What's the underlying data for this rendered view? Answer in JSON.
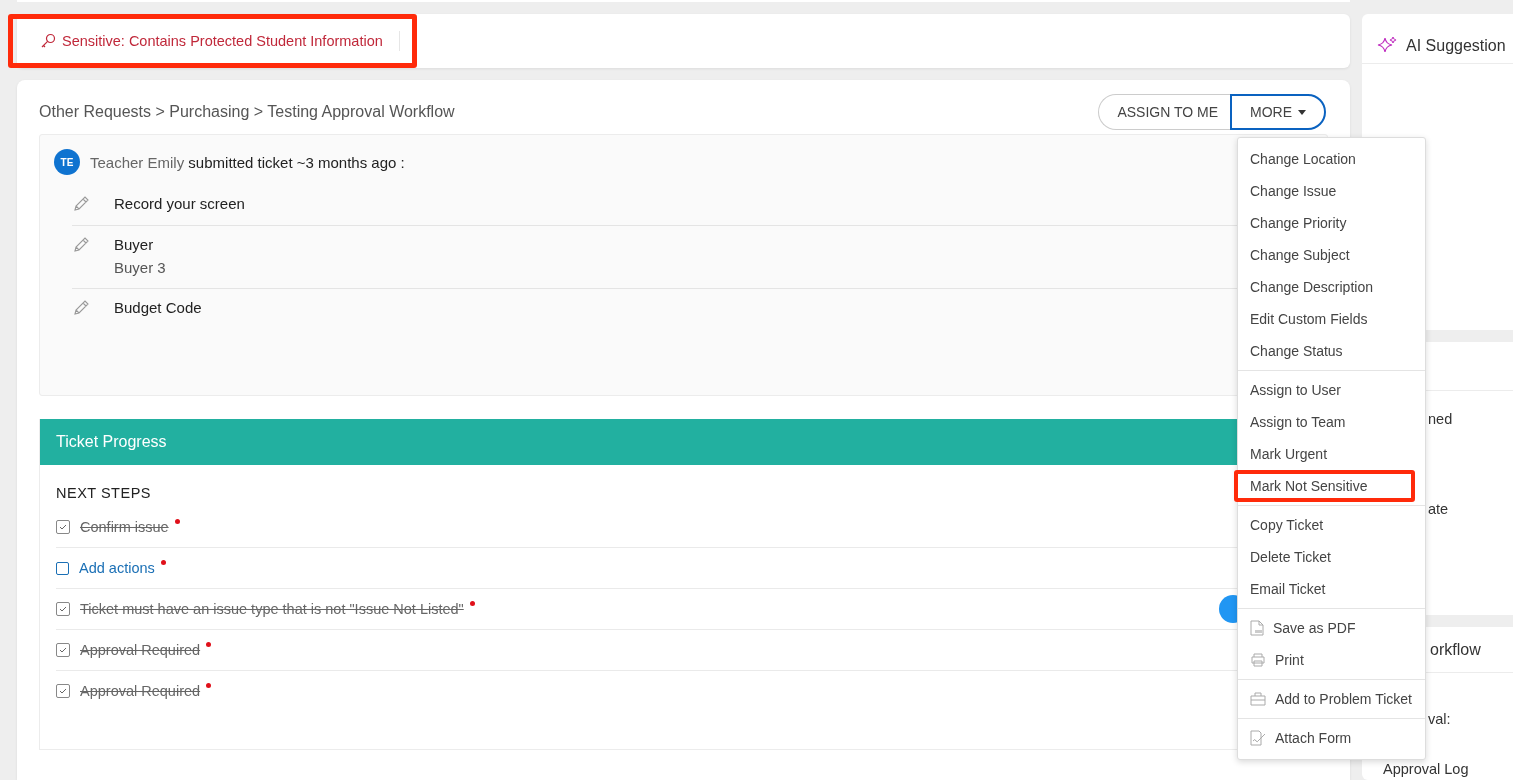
{
  "banner": {
    "text": "Sensitive: Contains Protected Student Information",
    "highlighted": true
  },
  "breadcrumb": "Other Requests > Purchasing > Testing Approval Workflow",
  "actions": {
    "assign": "ASSIGN TO ME",
    "more": "MORE",
    "more_expanded": true
  },
  "submission": {
    "initials": "TE",
    "author": "Teacher Emily",
    "summary": "submitted ticket ~3 months ago :",
    "fields": [
      {
        "label": "Record your screen"
      },
      {
        "label": "Buyer",
        "value": "Buyer 3"
      },
      {
        "label": "Budget Code"
      }
    ]
  },
  "progress": {
    "title": "Ticket Progress",
    "heading": "NEXT STEPS",
    "steps": [
      {
        "text": "Confirm issue",
        "checked": true,
        "required": true
      },
      {
        "text": "Add actions",
        "checked": false,
        "required": true
      },
      {
        "text": "Ticket must have an issue type that is not \"Issue Not Listed\"",
        "checked": true,
        "required": true
      },
      {
        "text": "Approval Required",
        "checked": true,
        "required": true
      },
      {
        "text": "Approval Required",
        "checked": true,
        "required": true
      }
    ]
  },
  "menu": [
    [
      {
        "label": "Change Location"
      },
      {
        "label": "Change Issue"
      },
      {
        "label": "Change Priority"
      },
      {
        "label": "Change Subject"
      },
      {
        "label": "Change Description"
      },
      {
        "label": "Edit Custom Fields"
      },
      {
        "label": "Change Status"
      }
    ],
    [
      {
        "label": "Assign to User"
      },
      {
        "label": "Assign to Team"
      },
      {
        "label": "Mark Urgent"
      },
      {
        "label": "Mark Not Sensitive",
        "highlighted": true
      }
    ],
    [
      {
        "label": "Copy Ticket"
      },
      {
        "label": "Delete Ticket"
      },
      {
        "label": "Email Ticket"
      }
    ],
    [
      {
        "label": "Save as PDF",
        "kind": "pdf"
      },
      {
        "label": "Print",
        "kind": "printer"
      }
    ],
    [
      {
        "label": "Add to Problem Ticket",
        "kind": "briefcase"
      }
    ],
    [
      {
        "label": "Attach Form",
        "kind": "form"
      }
    ]
  ],
  "side": {
    "ai_title": "AI Suggestion",
    "details": [
      "ned",
      "ate"
    ],
    "workflow_title": "orkflow",
    "workflow_lines": [
      "val:",
      "Approval Log"
    ]
  }
}
